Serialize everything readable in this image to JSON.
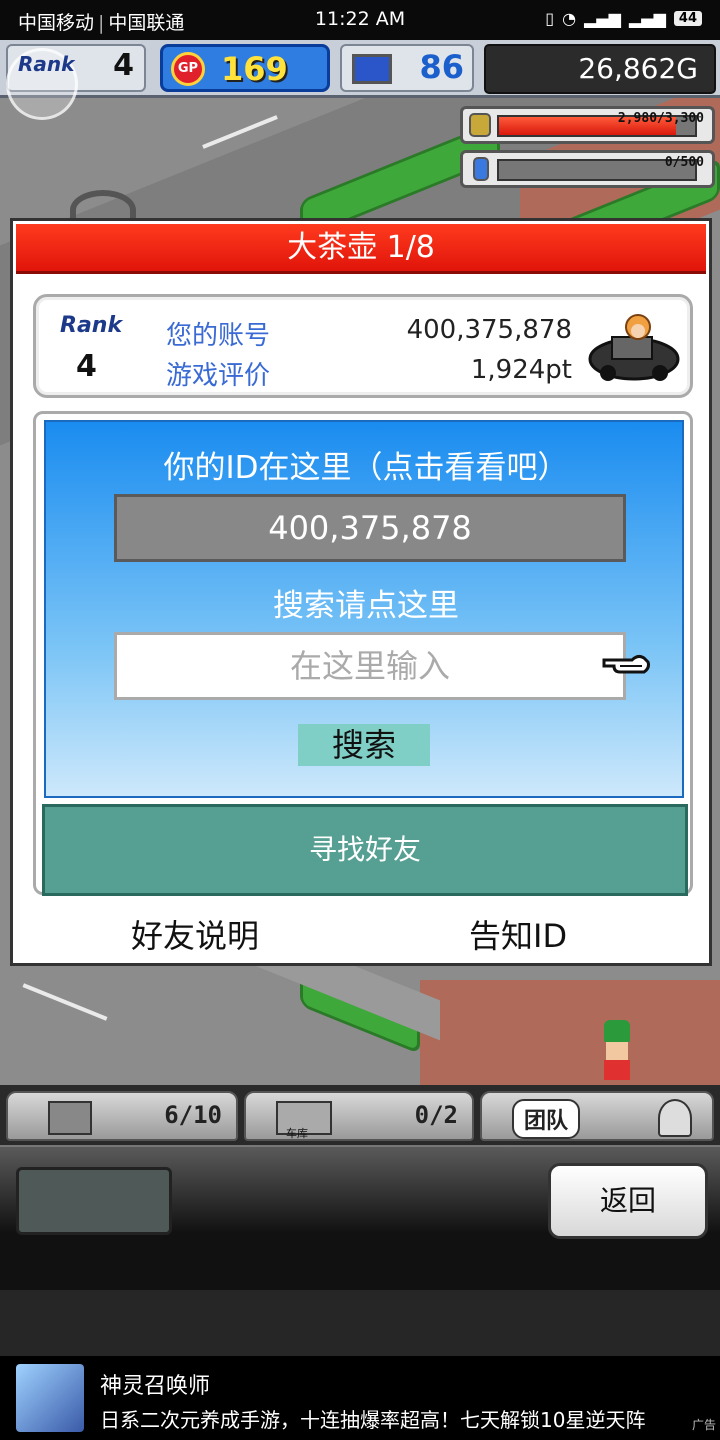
{
  "status_bar": {
    "carrier_1": "中国移动",
    "carrier_2": "中国联通",
    "time": "11:22 AM",
    "battery": "44"
  },
  "hud": {
    "rank_label": "Rank",
    "rank_value": "4",
    "gp_label": "GP",
    "gp_value": "169",
    "pc_value": "86",
    "gold": "26,862G"
  },
  "resources": [
    {
      "name": "fuel",
      "text": "2,980/3,300",
      "fraction": 0.903,
      "icon": "barrel-icon"
    },
    {
      "name": "water",
      "text": "0/500",
      "fraction": 0.0,
      "icon": "bottle-icon"
    }
  ],
  "dialog": {
    "title": "大茶壶 1/8",
    "account": {
      "rank_label": "Rank",
      "rank_value": "4",
      "id_label": "您的账号",
      "id_value": "400,375,878",
      "rating_label": "游戏评价",
      "rating_value": "1,924pt"
    },
    "search": {
      "id_hint": "你的ID在这里（点击看看吧）",
      "id_value": "400,375,878",
      "search_hint": "搜索请点这里",
      "input_placeholder": "在这里输入",
      "search_button": "搜索",
      "find_friends_button": "寻找好友"
    },
    "footer": {
      "friend_help": "好友说明",
      "notify_id": "告知ID"
    }
  },
  "tabs": [
    {
      "name": "storage",
      "text": "6/10"
    },
    {
      "name": "garage",
      "text": "0/2",
      "sub": "车库"
    },
    {
      "name": "team",
      "text": "团队"
    }
  ],
  "panel": {
    "back_button": "返回"
  },
  "ad": {
    "title": "神灵召唤师",
    "description": "日系二次元养成手游，十连抽爆率超高！七天解锁10星逆天阵",
    "tag": "广告"
  },
  "colors": {
    "title_red": "#e0140a",
    "search_blue": "#1a8cf0",
    "find_teal": "#55a092",
    "label_blue": "#3a6ad4"
  }
}
